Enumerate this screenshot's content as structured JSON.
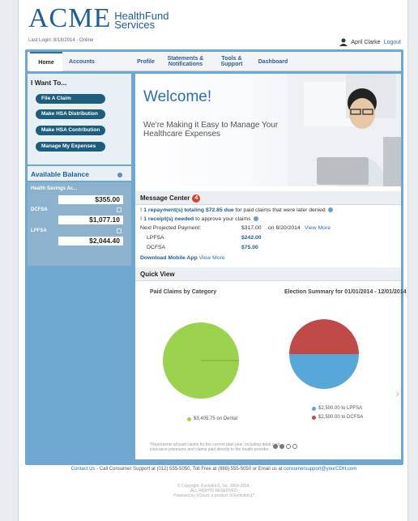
{
  "brand": {
    "name": "ACME",
    "subtitle_line1": "HealthFund",
    "subtitle_line2": "Services"
  },
  "header": {
    "last_login": "Last Login: 8/18/2014 - Online",
    "user_name": "April Clarke",
    "logout_label": "Logout",
    "icon": "user-icon"
  },
  "nav": {
    "items": [
      {
        "label": "Home",
        "active": true
      },
      {
        "label": "Accounts"
      },
      {
        "label": "Profile"
      },
      {
        "label": "Statements & Notifications"
      },
      {
        "label": "Tools & Support"
      },
      {
        "label": "Dashboard"
      }
    ]
  },
  "sidebar": {
    "iwant_title": "I Want To...",
    "actions": [
      {
        "label": "File A Claim"
      },
      {
        "label": "Make HSA Distribution"
      },
      {
        "label": "Make HSA Contribution"
      },
      {
        "label": "Manage My Expenses"
      }
    ],
    "balance_title": "Available Balance",
    "balances": [
      {
        "name": "Health Savings Ac...",
        "value": "$355.00"
      },
      {
        "name": "DCFSA",
        "value": "$1,077.10"
      },
      {
        "name": "LPFSA",
        "value": "$2,044.40"
      }
    ]
  },
  "hero": {
    "title": "Welcome!",
    "subtitle": "We're Making it Easy to Manage Your Healthcare Expenses"
  },
  "message_center": {
    "title": "Message Center",
    "count": "4",
    "line1_prefix": "1 repayment(s) totaling",
    "line1_amount": "$72.85 due",
    "line1_suffix": "for paid claims that were later denied",
    "line2_bold": "1 receipt(s) needed",
    "line2_suffix": "to approve your claims",
    "projected_label": "Next Projected Payment:",
    "projected_amount": "$317.00",
    "projected_date": "on 8/20/2014",
    "projected_link": "View More",
    "rows": [
      {
        "name": "LPFSA",
        "amount": "$242.00"
      },
      {
        "name": "DCFSA",
        "amount": "$75.00"
      }
    ],
    "download_label": "Download Mobile App",
    "download_link": "View More"
  },
  "quick_view": {
    "title": "Quick View",
    "paid_title": "Paid Claims by Category",
    "election_title": "Election Summary for 01/01/2014 - 12/01/2014",
    "paid_legend": "$3,405.75 on Dental",
    "election_legend": [
      "$2,500.00 to LPFSA",
      "$2,500.00 to DCFSA"
    ],
    "footnote": "*Represents all paid claims for the current plan year, including debit card, insurance premiums and claims paid directly to the health provider."
  },
  "chart_data": [
    {
      "type": "pie",
      "title": "Paid Claims by Category",
      "slices": [
        {
          "label": "$3,405.75 on Dental",
          "value": 3405.75,
          "color": "#9bd24e"
        }
      ]
    },
    {
      "type": "pie",
      "title": "Election Summary for 01/01/2014 - 12/01/2014",
      "slices": [
        {
          "label": "$2,500.00 to LPFSA",
          "value": 2500,
          "color": "#57a8d6"
        },
        {
          "label": "$2,500.00 to DCFSA",
          "value": 2500,
          "color": "#c04a47"
        }
      ]
    }
  ],
  "footer": {
    "contact_prefix": "Contact Us",
    "contact_text": " - Call Consumer Support at (012) 555-5050, Toll Free at (888) 555-5050 or Email us at ",
    "contact_email": "consumersupport@yourCDH.com",
    "copyright_line1": "© Copyright, Evolution1, Inc. 2004-2014,",
    "copyright_line2": "ALL RIGHTS RESERVED",
    "copyright_line3": "Powered by 1Cloud, a product of Evolution1*"
  }
}
